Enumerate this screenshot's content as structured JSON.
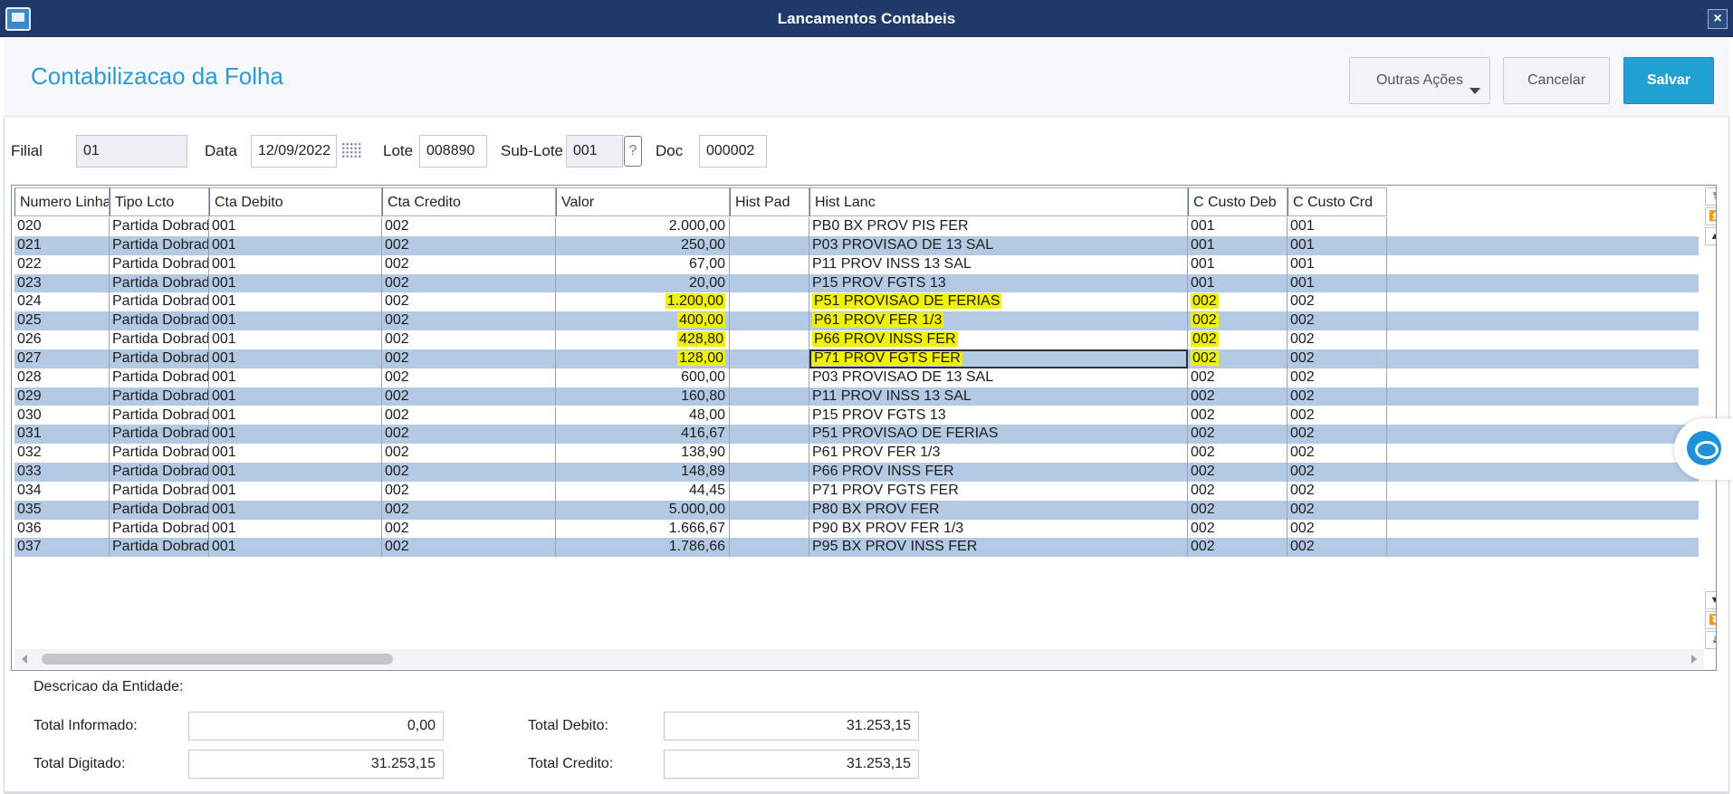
{
  "window": {
    "title": "Lancamentos Contabeis",
    "close_label": "×"
  },
  "header": {
    "title": "Contabilizacao da Folha",
    "buttons": {
      "outras": "Outras Ações",
      "cancelar": "Cancelar",
      "salvar": "Salvar"
    }
  },
  "form": {
    "filial_label": "Filial",
    "filial_value": "01",
    "data_label": "Data",
    "data_value": "12/09/2022",
    "lote_label": "Lote",
    "lote_value": "008890",
    "sublote_label": "Sub-Lote",
    "sublote_value": "001",
    "sublote_help": "?",
    "doc_label": "Doc",
    "doc_value": "000002"
  },
  "grid": {
    "columns": [
      "Numero Linha",
      "Tipo Lcto",
      "Cta Debito",
      "Cta Credito",
      "Valor",
      "Hist Pad",
      "Hist Lanc",
      "C Custo Deb",
      "C Custo Crd"
    ],
    "rows": [
      {
        "num": "020",
        "tipo": "Partida Dobrada",
        "deb": "001",
        "cred": "002",
        "valor": "2.000,00",
        "histpad": "",
        "hist": "PB0 BX PROV PIS FER",
        "ccdeb": "001",
        "cccrd": "001"
      },
      {
        "num": "021",
        "tipo": "Partida Dobrada",
        "deb": "001",
        "cred": "002",
        "valor": "250,00",
        "histpad": "",
        "hist": "P03 PROVISAO DE 13 SAL",
        "ccdeb": "001",
        "cccrd": "001"
      },
      {
        "num": "022",
        "tipo": "Partida Dobrada",
        "deb": "001",
        "cred": "002",
        "valor": "67,00",
        "histpad": "",
        "hist": "P11 PROV INSS 13  SAL",
        "ccdeb": "001",
        "cccrd": "001"
      },
      {
        "num": "023",
        "tipo": "Partida Dobrada",
        "deb": "001",
        "cred": "002",
        "valor": "20,00",
        "histpad": "",
        "hist": "P15 PROV FGTS 13",
        "ccdeb": "001",
        "cccrd": "001"
      },
      {
        "num": "024",
        "tipo": "Partida Dobrada",
        "deb": "001",
        "cred": "002",
        "valor": "1.200,00",
        "histpad": "",
        "hist": "P51 PROVISAO DE FERIAS",
        "ccdeb": "002",
        "cccrd": "002"
      },
      {
        "num": "025",
        "tipo": "Partida Dobrada",
        "deb": "001",
        "cred": "002",
        "valor": "400,00",
        "histpad": "",
        "hist": "P61 PROV FER 1/3",
        "ccdeb": "002",
        "cccrd": "002"
      },
      {
        "num": "026",
        "tipo": "Partida Dobrada",
        "deb": "001",
        "cred": "002",
        "valor": "428,80",
        "histpad": "",
        "hist": "P66 PROV INSS FER",
        "ccdeb": "002",
        "cccrd": "002"
      },
      {
        "num": "027",
        "tipo": "Partida Dobrada",
        "deb": "001",
        "cred": "002",
        "valor": "128,00",
        "histpad": "",
        "hist": "P71 PROV FGTS FER",
        "ccdeb": "002",
        "cccrd": "002"
      },
      {
        "num": "028",
        "tipo": "Partida Dobrada",
        "deb": "001",
        "cred": "002",
        "valor": "600,00",
        "histpad": "",
        "hist": "P03 PROVISAO DE 13 SAL",
        "ccdeb": "002",
        "cccrd": "002"
      },
      {
        "num": "029",
        "tipo": "Partida Dobrada",
        "deb": "001",
        "cred": "002",
        "valor": "160,80",
        "histpad": "",
        "hist": "P11 PROV INSS 13  SAL",
        "ccdeb": "002",
        "cccrd": "002"
      },
      {
        "num": "030",
        "tipo": "Partida Dobrada",
        "deb": "001",
        "cred": "002",
        "valor": "48,00",
        "histpad": "",
        "hist": "P15 PROV FGTS 13",
        "ccdeb": "002",
        "cccrd": "002"
      },
      {
        "num": "031",
        "tipo": "Partida Dobrada",
        "deb": "001",
        "cred": "002",
        "valor": "416,67",
        "histpad": "",
        "hist": "P51 PROVISAO DE FERIAS",
        "ccdeb": "002",
        "cccrd": "002"
      },
      {
        "num": "032",
        "tipo": "Partida Dobrada",
        "deb": "001",
        "cred": "002",
        "valor": "138,90",
        "histpad": "",
        "hist": "P61 PROV FER 1/3",
        "ccdeb": "002",
        "cccrd": "002"
      },
      {
        "num": "033",
        "tipo": "Partida Dobrada",
        "deb": "001",
        "cred": "002",
        "valor": "148,89",
        "histpad": "",
        "hist": "P66 PROV INSS FER",
        "ccdeb": "002",
        "cccrd": "002"
      },
      {
        "num": "034",
        "tipo": "Partida Dobrada",
        "deb": "001",
        "cred": "002",
        "valor": "44,45",
        "histpad": "",
        "hist": "P71 PROV FGTS FER",
        "ccdeb": "002",
        "cccrd": "002"
      },
      {
        "num": "035",
        "tipo": "Partida Dobrada",
        "deb": "001",
        "cred": "002",
        "valor": "5.000,00",
        "histpad": "",
        "hist": "P80 BX PROV FER",
        "ccdeb": "002",
        "cccrd": "002"
      },
      {
        "num": "036",
        "tipo": "Partida Dobrada",
        "deb": "001",
        "cred": "002",
        "valor": "1.666,67",
        "histpad": "",
        "hist": "P90 BX PROV FER 1/3",
        "ccdeb": "002",
        "cccrd": "002"
      },
      {
        "num": "037",
        "tipo": "Partida Dobrada",
        "deb": "001",
        "cred": "002",
        "valor": "1.786,66",
        "histpad": "",
        "hist": "P95 BX PROV INSS FER",
        "ccdeb": "002",
        "cccrd": "002"
      }
    ],
    "highlighted_rows": [
      "024",
      "025",
      "026",
      "027"
    ],
    "selected_row": "027",
    "highlight_color": "#f0f200",
    "alt_row_color": "#b4c9e4"
  },
  "footer": {
    "descricao_label": "Descricao da Entidade:",
    "total_informado_label": "Total Informado:",
    "total_informado_value": "0,00",
    "total_digitado_label": "Total Digitado:",
    "total_digitado_value": "31.253,15",
    "total_debito_label": "Total Debito:",
    "total_debito_value": "31.253,15",
    "total_credito_label": "Total Credito:",
    "total_credito_value": "31.253,15"
  },
  "colors": {
    "titlebar": "#1f3a68",
    "accent": "#2c9ad1",
    "primary_button": "#1fa1d2"
  }
}
